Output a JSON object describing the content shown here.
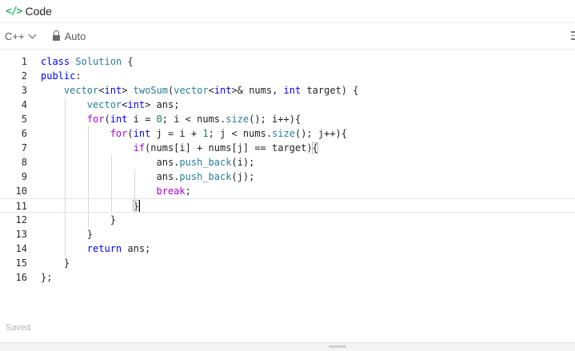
{
  "header": {
    "icon": "code-icon",
    "icon_glyph": "</>",
    "title": "Code"
  },
  "toolbar": {
    "language": "C++",
    "mode": "Auto"
  },
  "editor": {
    "current_line": 11,
    "lines": [
      {
        "n": "1",
        "text": "class Solution {"
      },
      {
        "n": "2",
        "text": "public:"
      },
      {
        "n": "3",
        "text": "    vector<int> twoSum(vector<int>& nums, int target) {"
      },
      {
        "n": "4",
        "text": "        vector<int> ans;"
      },
      {
        "n": "5",
        "text": "        for(int i = 0; i < nums.size(); i++){"
      },
      {
        "n": "6",
        "text": "            for(int j = i + 1; j < nums.size(); j++){"
      },
      {
        "n": "7",
        "text": "                if(nums[i] + nums[j] == target){"
      },
      {
        "n": "8",
        "text": "                    ans.push_back(i);"
      },
      {
        "n": "9",
        "text": "                    ans.push_back(j);"
      },
      {
        "n": "10",
        "text": "                    break;"
      },
      {
        "n": "11",
        "text": "                }"
      },
      {
        "n": "12",
        "text": "            }"
      },
      {
        "n": "13",
        "text": "        }"
      },
      {
        "n": "14",
        "text": "        return ans;"
      },
      {
        "n": "15",
        "text": "    }"
      },
      {
        "n": "16",
        "text": "};"
      }
    ]
  },
  "status": {
    "text": "Saved"
  },
  "colors": {
    "accent": "#2db55d",
    "keyword": "#0000ff",
    "control": "#af00db",
    "type": "#267f99"
  }
}
